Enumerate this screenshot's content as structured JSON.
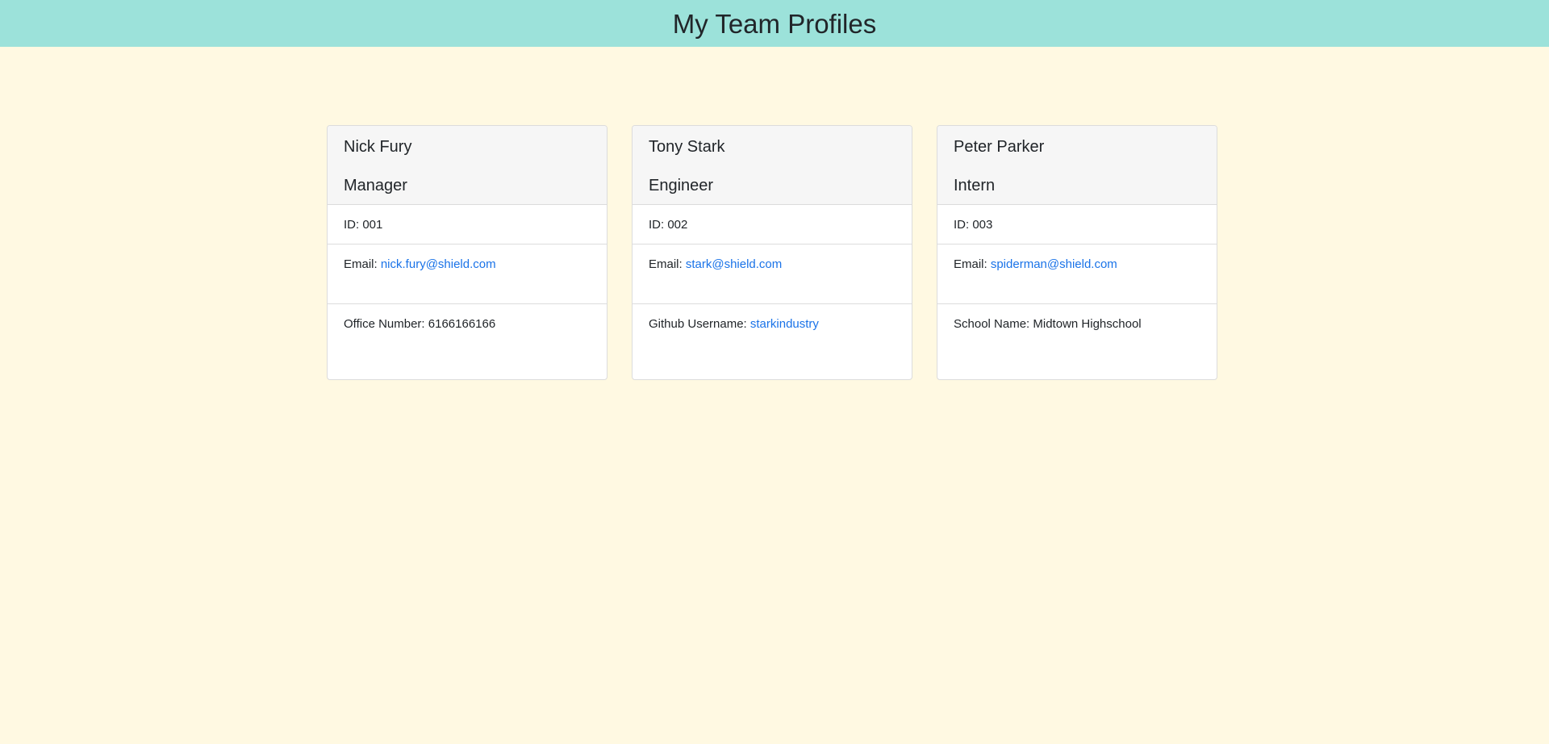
{
  "header": {
    "title": "My Team Profiles"
  },
  "colors": {
    "header_bg": "#9ce2da",
    "page_bg": "#fff9e2",
    "link": "#1a73e8"
  },
  "cards": [
    {
      "name": "Nick Fury",
      "role": "Manager",
      "id_label": "ID: 001",
      "email_label": "Email: ",
      "email": "nick.fury@shield.com",
      "extra_label": "Office Number: ",
      "extra_value": "6166166166"
    },
    {
      "name": "Tony Stark",
      "role": "Engineer",
      "id_label": "ID: 002",
      "email_label": "Email: ",
      "email": "stark@shield.com",
      "extra_label": "Github Username: ",
      "extra_value": "starkindustry"
    },
    {
      "name": "Peter Parker",
      "role": "Intern",
      "id_label": "ID: 003",
      "email_label": "Email: ",
      "email": "spiderman@shield.com",
      "extra_label": "School Name: ",
      "extra_value": "Midtown Highschool"
    }
  ]
}
